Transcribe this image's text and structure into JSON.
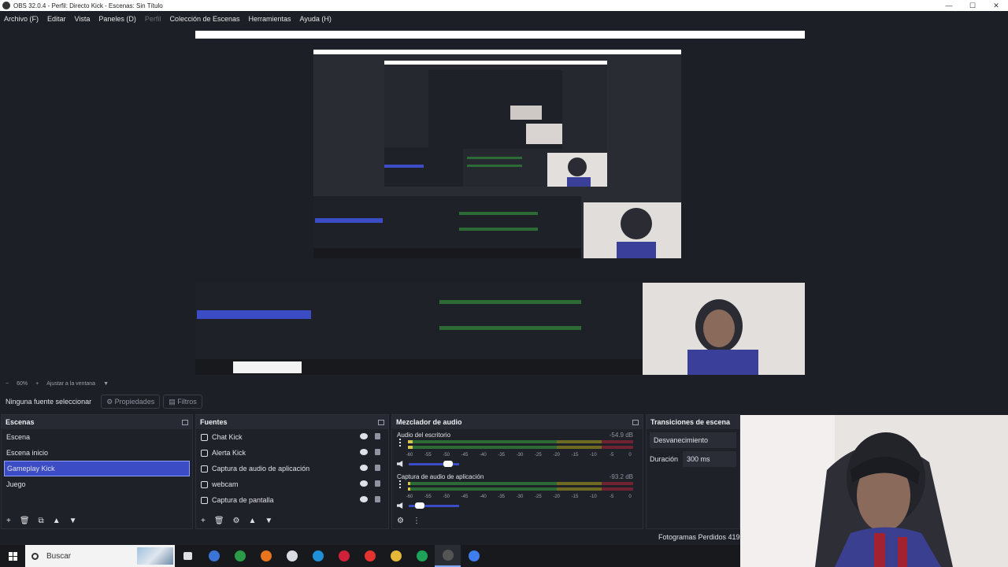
{
  "window": {
    "title": "OBS 32.0.4 - Perfil: Directo Kick - Escenas: Sin Título",
    "minimize": "—",
    "maximize": "☐",
    "close": "✕"
  },
  "menu": [
    "Archivo (F)",
    "Editar",
    "Vista",
    "Paneles (D)",
    "Perfil",
    "Colección de Escenas",
    "Herramientas",
    "Ayuda (H)"
  ],
  "zoom": {
    "minus": "−",
    "value": "60%",
    "plus": "+",
    "fit": "Ajustar a la ventana",
    "caret": "▼"
  },
  "properties_bar": {
    "no_source": "Ninguna fuente seleccionar",
    "properties": "Propiedades",
    "filters": "Filtros"
  },
  "scenes": {
    "title": "Escenas",
    "items": [
      "Escena",
      "Escena inicio",
      "Gameplay Kick",
      "Juego"
    ],
    "selected": 2,
    "footer": [
      "+",
      "🗑",
      "⧉",
      "▲",
      "▼"
    ]
  },
  "sources": {
    "title": "Fuentes",
    "items": [
      "Chat Kick",
      "Alerta Kick",
      "Captura de audio de aplicación",
      "webcam",
      "Captura de pantalla"
    ],
    "footer": [
      "+",
      "🗑",
      "⚙",
      "▲",
      "▼"
    ]
  },
  "mixer": {
    "title": "Mezclador de audio",
    "tracks": [
      {
        "name": "Audio del escritorio",
        "db": "-54.9 dB",
        "level": 0.02,
        "volume": 0.85
      },
      {
        "name": "Captura de audio de aplicación",
        "db": "-93.2 dB",
        "level": 0.01,
        "volume": 0.15
      }
    ],
    "ticks": [
      "-60",
      "-55",
      "-50",
      "-45",
      "-40",
      "-35",
      "-30",
      "-25",
      "-20",
      "-15",
      "-10",
      "-5",
      "0"
    ],
    "footer": [
      "⚙",
      "⋮"
    ]
  },
  "transitions": {
    "title": "Transiciones de escena",
    "selected": "Desvanecimiento",
    "duration_label": "Duración",
    "duration_value": "300 ms"
  },
  "stats": {
    "dropped": "Fotogramas Perdidos 419"
  },
  "taskbar": {
    "search": "Buscar",
    "colors": [
      "#3b73d6",
      "#2a9c47",
      "#e8741e",
      "#d9dde3",
      "#1f8fd8",
      "#d0213a",
      "#e3342f",
      "#e5b83a",
      "#1fa35a",
      "#555555",
      "#3f7cf0"
    ]
  }
}
